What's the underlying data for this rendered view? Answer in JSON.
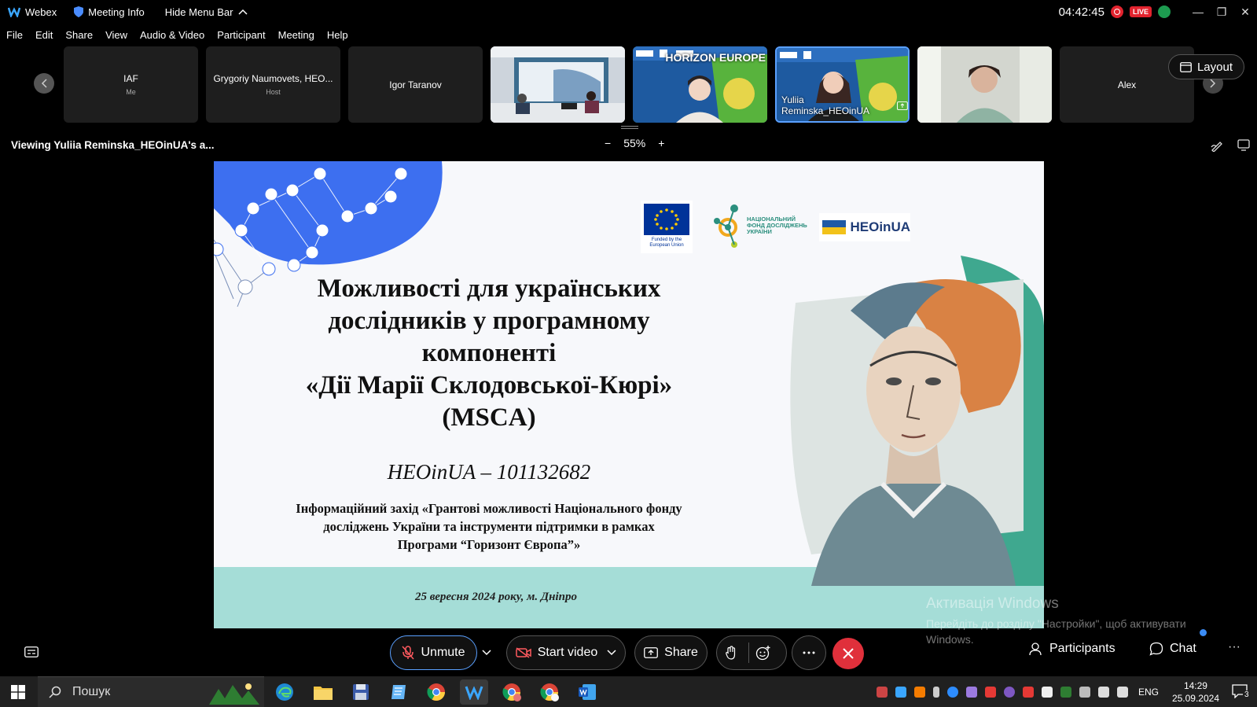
{
  "titlebar": {
    "app_name": "Webex",
    "meeting_info": "Meeting Info",
    "hide_menu_bar": "Hide Menu Bar",
    "clock": "04:42:45",
    "live_label": "LIVE"
  },
  "menu": {
    "items": [
      "File",
      "Edit",
      "Share",
      "View",
      "Audio & Video",
      "Participant",
      "Meeting",
      "Help"
    ]
  },
  "participants": [
    {
      "name": "IAF",
      "role": "Me"
    },
    {
      "name": "Grygoriy Naumovets, HEO...",
      "role": "Host"
    },
    {
      "name": "Igor Taranov",
      "role": ""
    },
    {
      "name": "",
      "role": ""
    },
    {
      "name": "",
      "role": ""
    },
    {
      "name": "Yuliia Reminska_HEOinUA",
      "role": ""
    },
    {
      "name": "",
      "role": ""
    },
    {
      "name": "Alex",
      "role": ""
    }
  ],
  "layout_button": "Layout",
  "viewing": {
    "text": "Viewing Yuliia Reminska_HEOinUA's a...",
    "zoom": "55%"
  },
  "slide": {
    "title_lines": [
      "Можливості для українських",
      "дослідників у програмному",
      "компоненті",
      "«Дії Марії Склодовської-Кюрі»",
      "(MSCA)"
    ],
    "code": "HEOinUA – 101132682",
    "info_lines": [
      "Інформаційний захід «Грантові можливості Національного фонду",
      "досліджень України та інструменти підтримки в рамках",
      "Програми “Горизонт Європа”»"
    ],
    "date": "25 вересня 2024 року, м. Дніпро",
    "eu_logo_text": "Funded by the European Union",
    "nfdu_logo_lines": [
      "НАЦІОНАЛЬНИЙ",
      "ФОНД ДОСЛІДЖЕНЬ",
      "УКРАЇНИ"
    ],
    "heo_logo_text": "HEOinUA",
    "horizon_text": "HORIZON EUROPE"
  },
  "activation": {
    "title": "Активація Windows",
    "message": "Перейдіть до розділу \"Настройки\", щоб активувати Windows."
  },
  "controls": {
    "unmute": "Unmute",
    "start_video": "Start video",
    "share": "Share",
    "participants": "Participants",
    "chat": "Chat"
  },
  "taskbar": {
    "search_placeholder": "Пошук",
    "lang": "ENG",
    "time": "14:29",
    "date": "25.09.2024",
    "notif_count": "3"
  },
  "colors": {
    "accent_blue": "#5aa0ff",
    "end_red": "#e0303b",
    "live_red": "#e2232e",
    "slide_teal": "#a5ddd7"
  }
}
